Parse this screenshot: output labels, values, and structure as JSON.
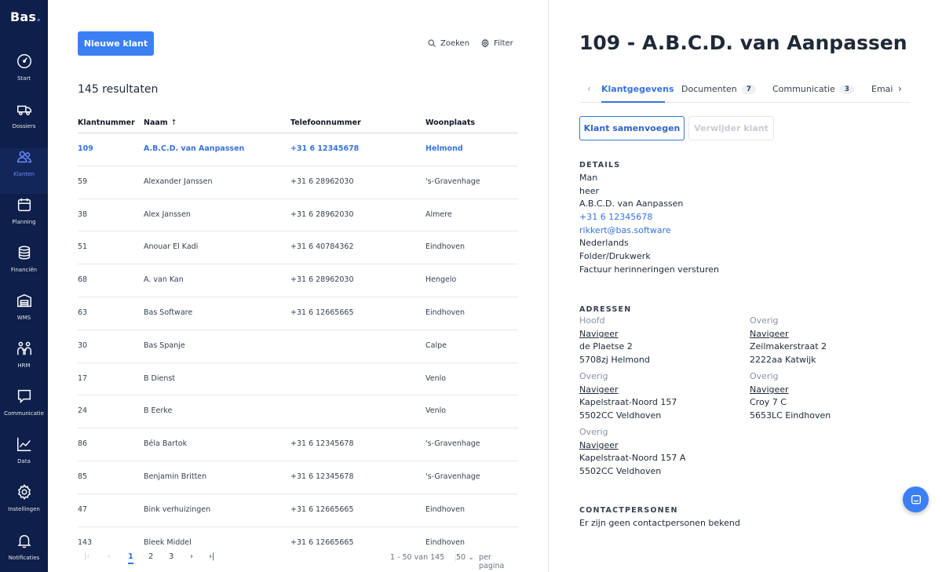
{
  "sidebar": {
    "logo": "Bas",
    "items": [
      {
        "label": "Start",
        "icon": "speedometer-icon"
      },
      {
        "label": "Dossiers",
        "icon": "truck-icon"
      },
      {
        "label": "Klanten",
        "icon": "users-icon"
      },
      {
        "label": "Planning",
        "icon": "calendar-icon"
      },
      {
        "label": "Financiën",
        "icon": "coins-icon"
      },
      {
        "label": "WMS",
        "icon": "warehouse-icon"
      },
      {
        "label": "HRM",
        "icon": "people-icon"
      },
      {
        "label": "Communicatie",
        "icon": "chat-icon"
      },
      {
        "label": "Data",
        "icon": "line-chart-icon"
      },
      {
        "label": "Instellingen",
        "icon": "gear-icon"
      },
      {
        "label": "Notificaties",
        "icon": "bell-icon"
      }
    ],
    "active_index": 2
  },
  "list": {
    "new_button": "Nieuwe klant",
    "search_label": "Zoeken",
    "filter_label": "Filter",
    "results": "145 resultaten",
    "columns": [
      "Klantnummer",
      "Naam",
      "Telefoonnummer",
      "Woonplaats"
    ],
    "sort_indicator": "↑",
    "rows": [
      {
        "nr": "109",
        "name": "A.B.C.D. van Aanpassen",
        "phone": "+31 6 12345678",
        "city": "Helmond"
      },
      {
        "nr": "59",
        "name": "Alexander Janssen",
        "phone": "+31 6 28962030",
        "city": "'s-Gravenhage"
      },
      {
        "nr": "38",
        "name": "Alex Janssen",
        "phone": "+31 6 28962030",
        "city": "Almere"
      },
      {
        "nr": "51",
        "name": "Anouar El Kadi",
        "phone": "+31 6 40784362",
        "city": "Eindhoven"
      },
      {
        "nr": "68",
        "name": "A. van Kan",
        "phone": "+31 6 28962030",
        "city": "Hengelo"
      },
      {
        "nr": "63",
        "name": "Bas Software",
        "phone": "+31 6 12665665",
        "city": "Eindhoven"
      },
      {
        "nr": "30",
        "name": "Bas Spanje",
        "phone": "",
        "city": "Calpe"
      },
      {
        "nr": "17",
        "name": "B Dienst",
        "phone": "",
        "city": "Venlo"
      },
      {
        "nr": "24",
        "name": "B Eerke",
        "phone": "",
        "city": "Venlo"
      },
      {
        "nr": "86",
        "name": "Béla Bartok",
        "phone": "+31 6 12345678",
        "city": "'s-Gravenhage"
      },
      {
        "nr": "85",
        "name": "Benjamin Britten",
        "phone": "+31 6 12345678",
        "city": "'s-Gravenhage"
      },
      {
        "nr": "47",
        "name": "Bink verhuizingen",
        "phone": "+31 6 12665665",
        "city": "Eindhoven"
      },
      {
        "nr": "143",
        "name": "Bleek Middel",
        "phone": "+31 6 12665665",
        "city": "Eindhoven"
      }
    ],
    "selected_index": 0,
    "pagination": {
      "first": "|‹",
      "prev": "‹",
      "pages": [
        "1",
        "2",
        "3"
      ],
      "current": "1",
      "next": "›",
      "last": "›|",
      "range": "1 - 50 van 145",
      "per_page_value": "50",
      "per_page_label": "per pagina"
    }
  },
  "detail": {
    "title": "109 - A.B.C.D. van Aanpassen",
    "tabs": [
      {
        "label": "Klantgegevens",
        "badge": ""
      },
      {
        "label": "Documenten",
        "badge": "7"
      },
      {
        "label": "Communicatie",
        "badge": "3"
      },
      {
        "label": "Emai",
        "badge": ""
      }
    ],
    "merge_button": "Klant samenvoegen",
    "delete_button": "Verwijder klant",
    "details_heading": "DETAILS",
    "details": {
      "gender": "Man",
      "salutation": "heer",
      "name": "A.B.C.D. van Aanpassen",
      "phone": "+31 6 12345678",
      "email": "rikkert@bas.software",
      "language": "Nederlands",
      "source": "Folder/Drukwerk",
      "reminders": "Factuur herinneringen versturen"
    },
    "addresses_heading": "ADRESSEN",
    "addresses": [
      {
        "type": "Hoofd",
        "navigate": "Navigeer",
        "street": "de Plaetse 2",
        "city": "5708zj Helmond"
      },
      {
        "type": "Overig",
        "navigate": "Navigeer",
        "street": "Zeilmakerstraat 2",
        "city": "2222aa Katwijk"
      },
      {
        "type": "Overig",
        "navigate": "Navigeer",
        "street": "Kapelstraat-Noord 157",
        "city": "5502CC Veldhoven"
      },
      {
        "type": "Overig",
        "navigate": "Navigeer",
        "street": "Croy 7 C",
        "city": "5653LC Eindhoven"
      },
      {
        "type": "Overig",
        "navigate": "Navigeer",
        "street": "Kapelstraat-Noord 157 A",
        "city": "5502CC Veldhoven"
      }
    ],
    "contacts_heading": "CONTACTPERSONEN",
    "contacts_empty": "Er zijn geen contactpersonen bekend"
  },
  "colors": {
    "sidebar": "#0d1f4a",
    "accent": "#3b7ff5",
    "link": "#3672e0"
  }
}
